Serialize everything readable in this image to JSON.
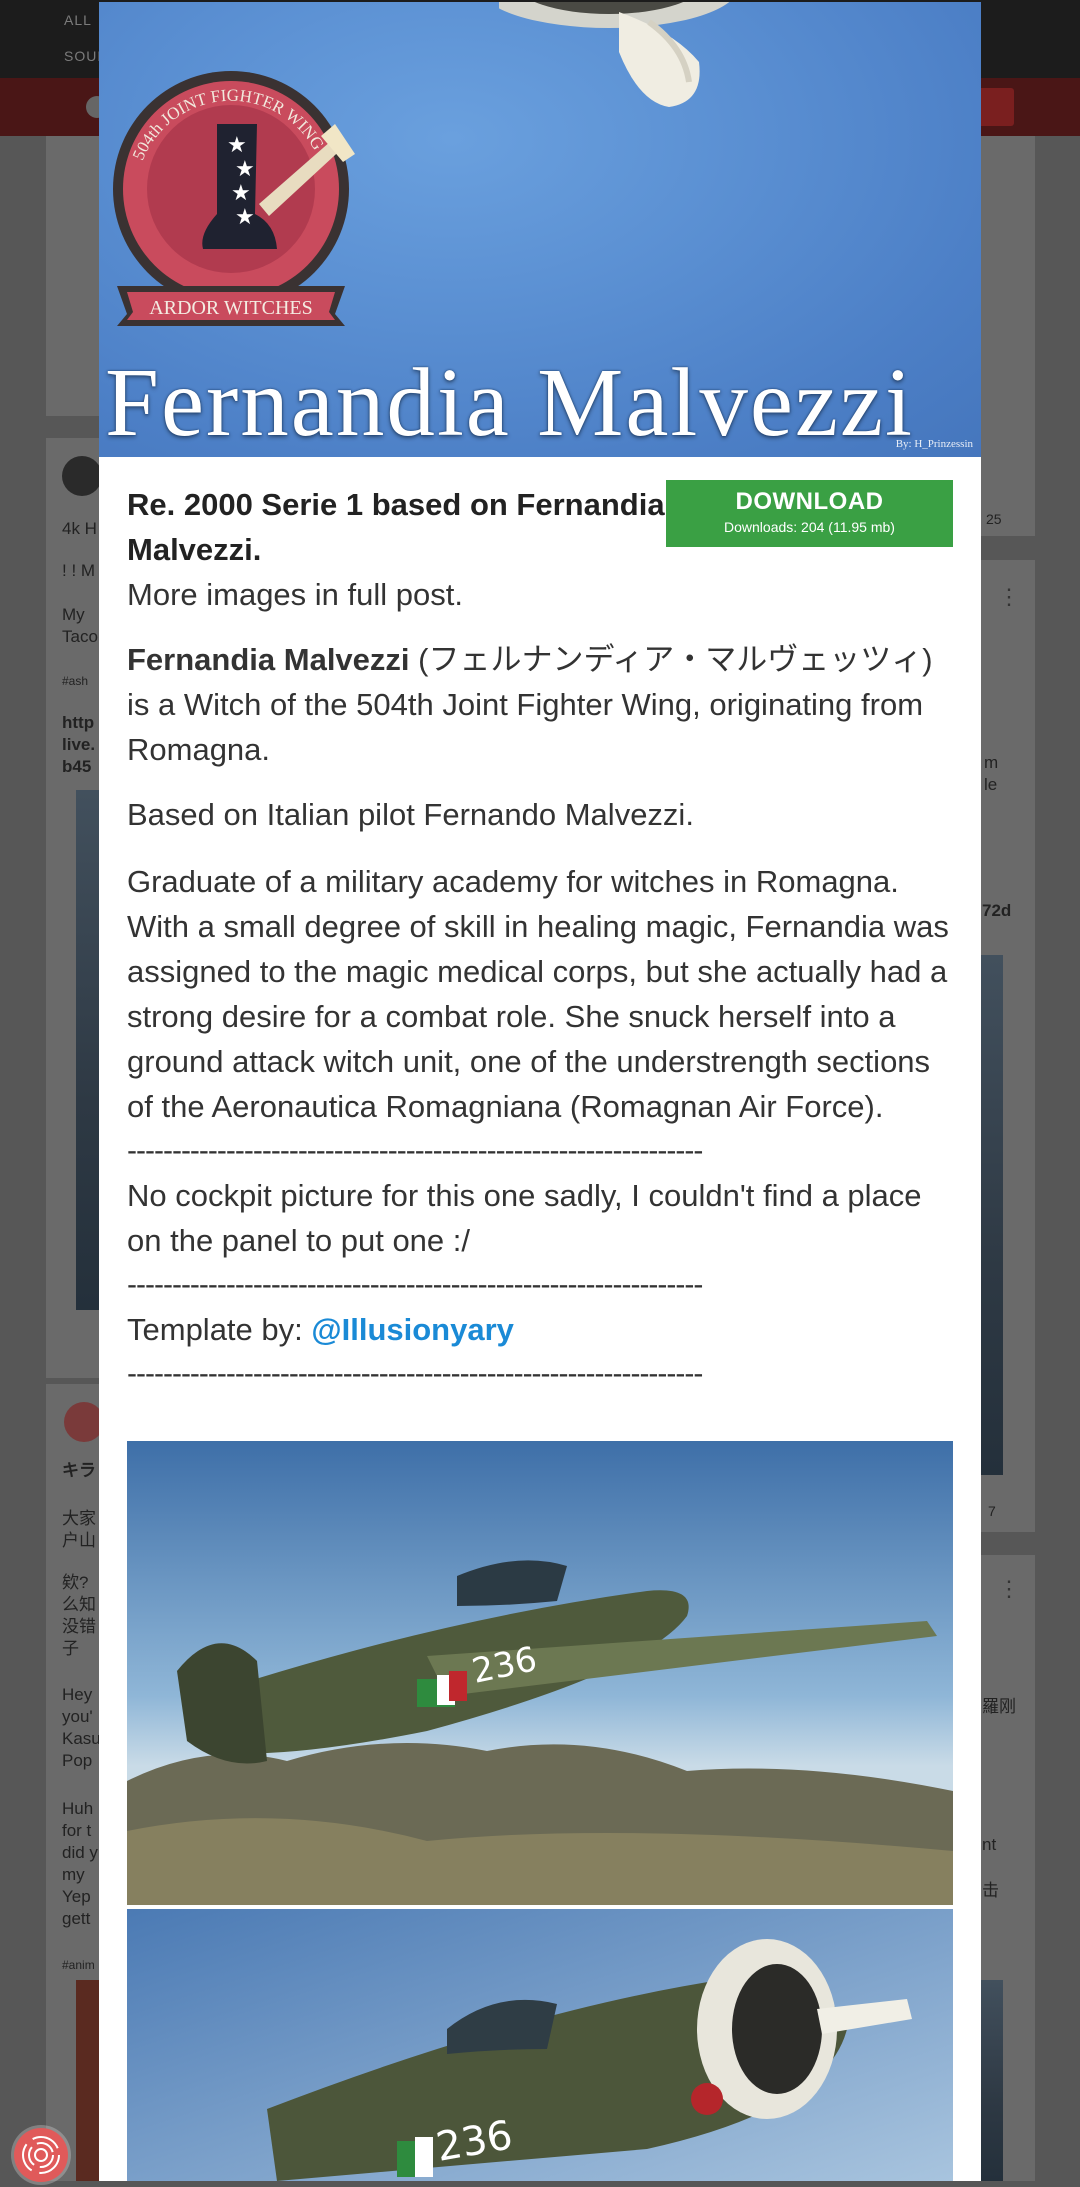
{
  "background_page": {
    "nav_items": [
      "ALL",
      "SOUN"
    ],
    "fragments_left": [
      "4k H",
      "! ! M",
      "My\nTaco",
      "#ash",
      "http\nlive.\nb45",
      "キラ",
      "大家\n户山",
      "欸?\n么知\n没错\n子",
      "Hey\nyou'\nKasu\nPop",
      "Huh\nfor t\ndid y\nmy\nYep\ngett",
      "#anim"
    ],
    "fragments_right": [
      "25",
      "m\nle",
      "72d",
      "7",
      "羅刚",
      "nt",
      "击"
    ]
  },
  "modal": {
    "banner": {
      "title": "Fernandia Malvezzi",
      "credit": "By: H_Prinzessin",
      "emblem_top_text": "504th JOINT FIGHTER WING",
      "emblem_bottom_text": "ARDOR WITCHES"
    },
    "download": {
      "label": "DOWNLOAD",
      "stats": "Downloads: 204 (11.95 mb)"
    },
    "post": {
      "lead": "Re. 2000 Serie 1 based on Fernandia Malvezzi.",
      "more_images": "More images in full post.",
      "name_bold": "Fernandia Malvezzi",
      "intro_rest": " (フェルナンディア・マルヴェッツィ) is a Witch of the 504th Joint Fighter Wing, originating from Romagna.",
      "based_on": "Based on Italian pilot Fernando Malvezzi.",
      "bio": "Graduate of a military academy for witches in Romagna. With a small degree of skill in healing magic, Fernandia was assigned to the magic medical corps, but she actually had a strong desire for a combat role. She snuck herself into a ground attack witch unit, one of the understrength sections of the Aeronautica Romagniana (Romagnan Air Force).",
      "separator": "----------------------------------------------------------------",
      "cockpit_note": "No cockpit picture for this one sadly, I couldn't find a place on the panel to put one :/",
      "template_label": "Template by: ",
      "template_author": "@Illusionyary",
      "aircraft_number": "236"
    }
  },
  "colors": {
    "download_green": "#3aa044",
    "mention_blue": "#1a8ad6",
    "banner_sky": "#5a8fd2"
  }
}
